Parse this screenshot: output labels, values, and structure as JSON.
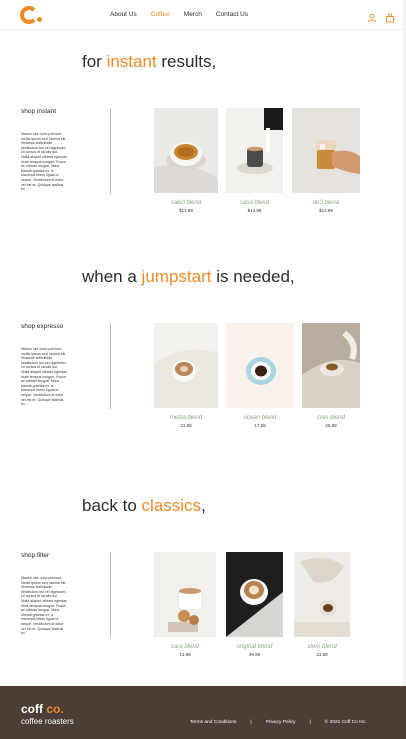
{
  "nav": {
    "items": [
      {
        "label": "About Us",
        "active": false
      },
      {
        "label": "Coffee",
        "active": true
      },
      {
        "label": "Merch",
        "active": false
      },
      {
        "label": "Contact Us",
        "active": false
      }
    ],
    "icons": [
      "user-icon",
      "cart-icon"
    ]
  },
  "colors": {
    "accent": "#f08a24",
    "footer_bg": "#4a3e37",
    "product_name": "#8fa68a"
  },
  "sections": [
    {
      "title_pre": "for ",
      "title_accent": "instant",
      "title_post": " results,",
      "shop_label": "shop instant",
      "description": "Mauris nec nunc pulvinar, mollis ipsum sed, lacinia elit. Vivamus sollicitudin vestibulum leo vel dignissim. Ut cursus et iaculis dui. Nulla aliquet ultrices egestas risus tempus congue. Fusce ac ultrices feugiat. Nunc blandit gravida ex, a maximus libero ligula id neque. Vestibulum id dolor vel est et. Quisque facilisis ex.",
      "products": [
        {
          "name": "cakio blend",
          "price": "$13.99"
        },
        {
          "name": "sasa blend",
          "price": "$13.99"
        },
        {
          "name": "de3 blend",
          "price": "$13.99"
        }
      ]
    },
    {
      "title_pre": "when a ",
      "title_accent": "jumpstart",
      "title_post": " is needed,",
      "shop_label": "shop expresso",
      "description": "Mauris nec nunc pulvinar, mollis ipsum sed, lacinia elit. Vivamus sollicitudin vestibulum leo vel dignissim. Ut cursus et iaculis dui. Nulla aliquet ultrices egestas risus tempus congue. Fusce ac ultrices feugiat. Nunc blandit gravida ex, a maximus libero ligula id neque. Vestibulum id dolor vel est et. Quisque facilisis ex.",
      "products": [
        {
          "name": "melza blend",
          "price": "21.99"
        },
        {
          "name": "ocean blend",
          "price": "17.99"
        },
        {
          "name": "cres blend",
          "price": "25.99"
        }
      ]
    },
    {
      "title_pre": "back to ",
      "title_accent": "classics",
      "title_post": ",",
      "shop_label": "shop filter",
      "description": "Mauris nec nunc pulvinar, mollis ipsum sed, lacinia elit. Vivamus sollicitudin vestibulum leo vel dignissim. Ut cursus et iaculis dui. Nulla aliquet ultrices egestas risus tempus congue. Fusce ac ultrices feugiat. Nunc blandit gravida ex, a maximus libero ligula id neque. Vestibulum id dolor vel est et. Quisque facilisis ex.",
      "products": [
        {
          "name": "cara blend",
          "price": "13.99"
        },
        {
          "name": "original blend",
          "price": "49.99"
        },
        {
          "name": "stem blend",
          "price": "23.99"
        }
      ]
    }
  ],
  "footer": {
    "brand_pre": "coff",
    "brand_accent": " co.",
    "subtitle": "coffee roasters",
    "links": [
      "Terms and Conditions",
      "Privacy Policy",
      "© 2021 Coff Co Inc."
    ],
    "separator": "|"
  }
}
